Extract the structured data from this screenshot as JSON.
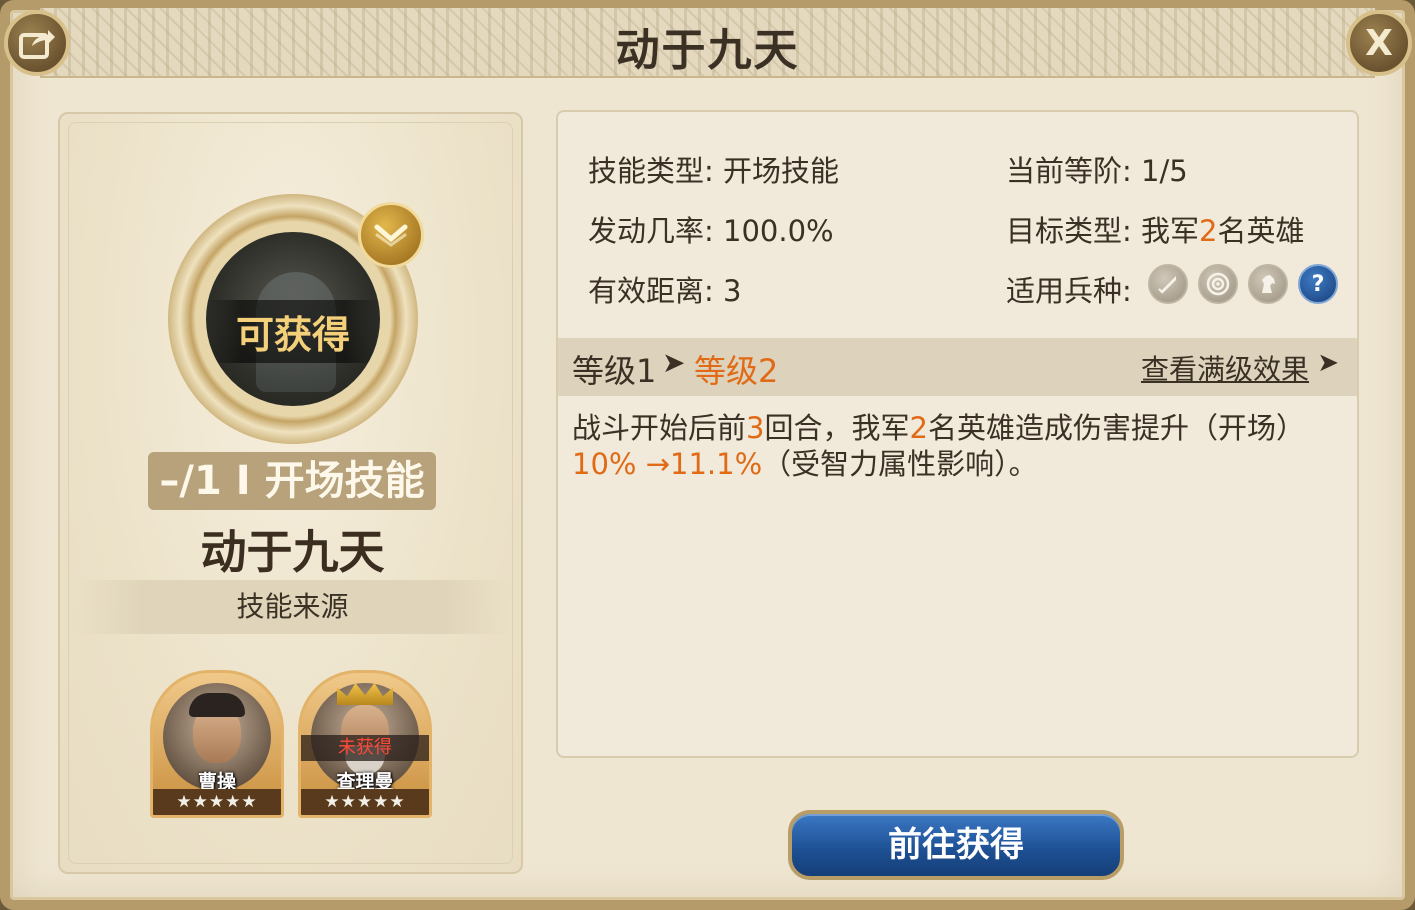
{
  "header": {
    "title": "动于九天"
  },
  "buttons": {
    "share_icon": "share-icon",
    "close_label": "X",
    "go_obtain": "前往获得"
  },
  "skill": {
    "status": "可获得",
    "expand_icon": "chevron-down-icon",
    "tag": "–/1 I 开场技能",
    "name": "动于九天",
    "source_label": "技能来源"
  },
  "heroes": [
    {
      "name": "曹操",
      "stars": "★★★★★",
      "owned": true
    },
    {
      "name": "查理曼",
      "stars": "★★★★★",
      "owned": false,
      "status": "未获得"
    }
  ],
  "attributes": {
    "skill_type_label": "技能类型:",
    "skill_type_value": "开场技能",
    "current_rank_label": "当前等阶:",
    "current_rank_value": "1/5",
    "trigger_rate_label": "发动几率:",
    "trigger_rate_value": "100.0%",
    "target_type_label": "目标类型:",
    "target_type_prefix": "我军",
    "target_type_count": "2",
    "target_type_suffix": "名英雄",
    "range_label": "有效距离:",
    "range_value": "3",
    "troop_label": "适用兵种:",
    "troops": [
      "sword-icon",
      "target-icon",
      "horse-icon",
      "help-icon"
    ],
    "help_glyph": "?"
  },
  "level": {
    "current": "等级1",
    "arrow": "➤",
    "next": "等级2",
    "view_max": "查看满级效果",
    "view_max_arrow": "➤"
  },
  "description": {
    "part1": "战斗开始后前",
    "rounds": "3",
    "part2": "回合，我军",
    "heroes": "2",
    "part3": "名英雄造成伤害提升（开场）",
    "from": "10%",
    "arrow": " →",
    "to": "11.1%",
    "part4": "（受智力属性影响）。"
  },
  "colors": {
    "highlight": "#e06a16",
    "button_blue": "#1d4f92",
    "frame": "#b59a6a"
  }
}
